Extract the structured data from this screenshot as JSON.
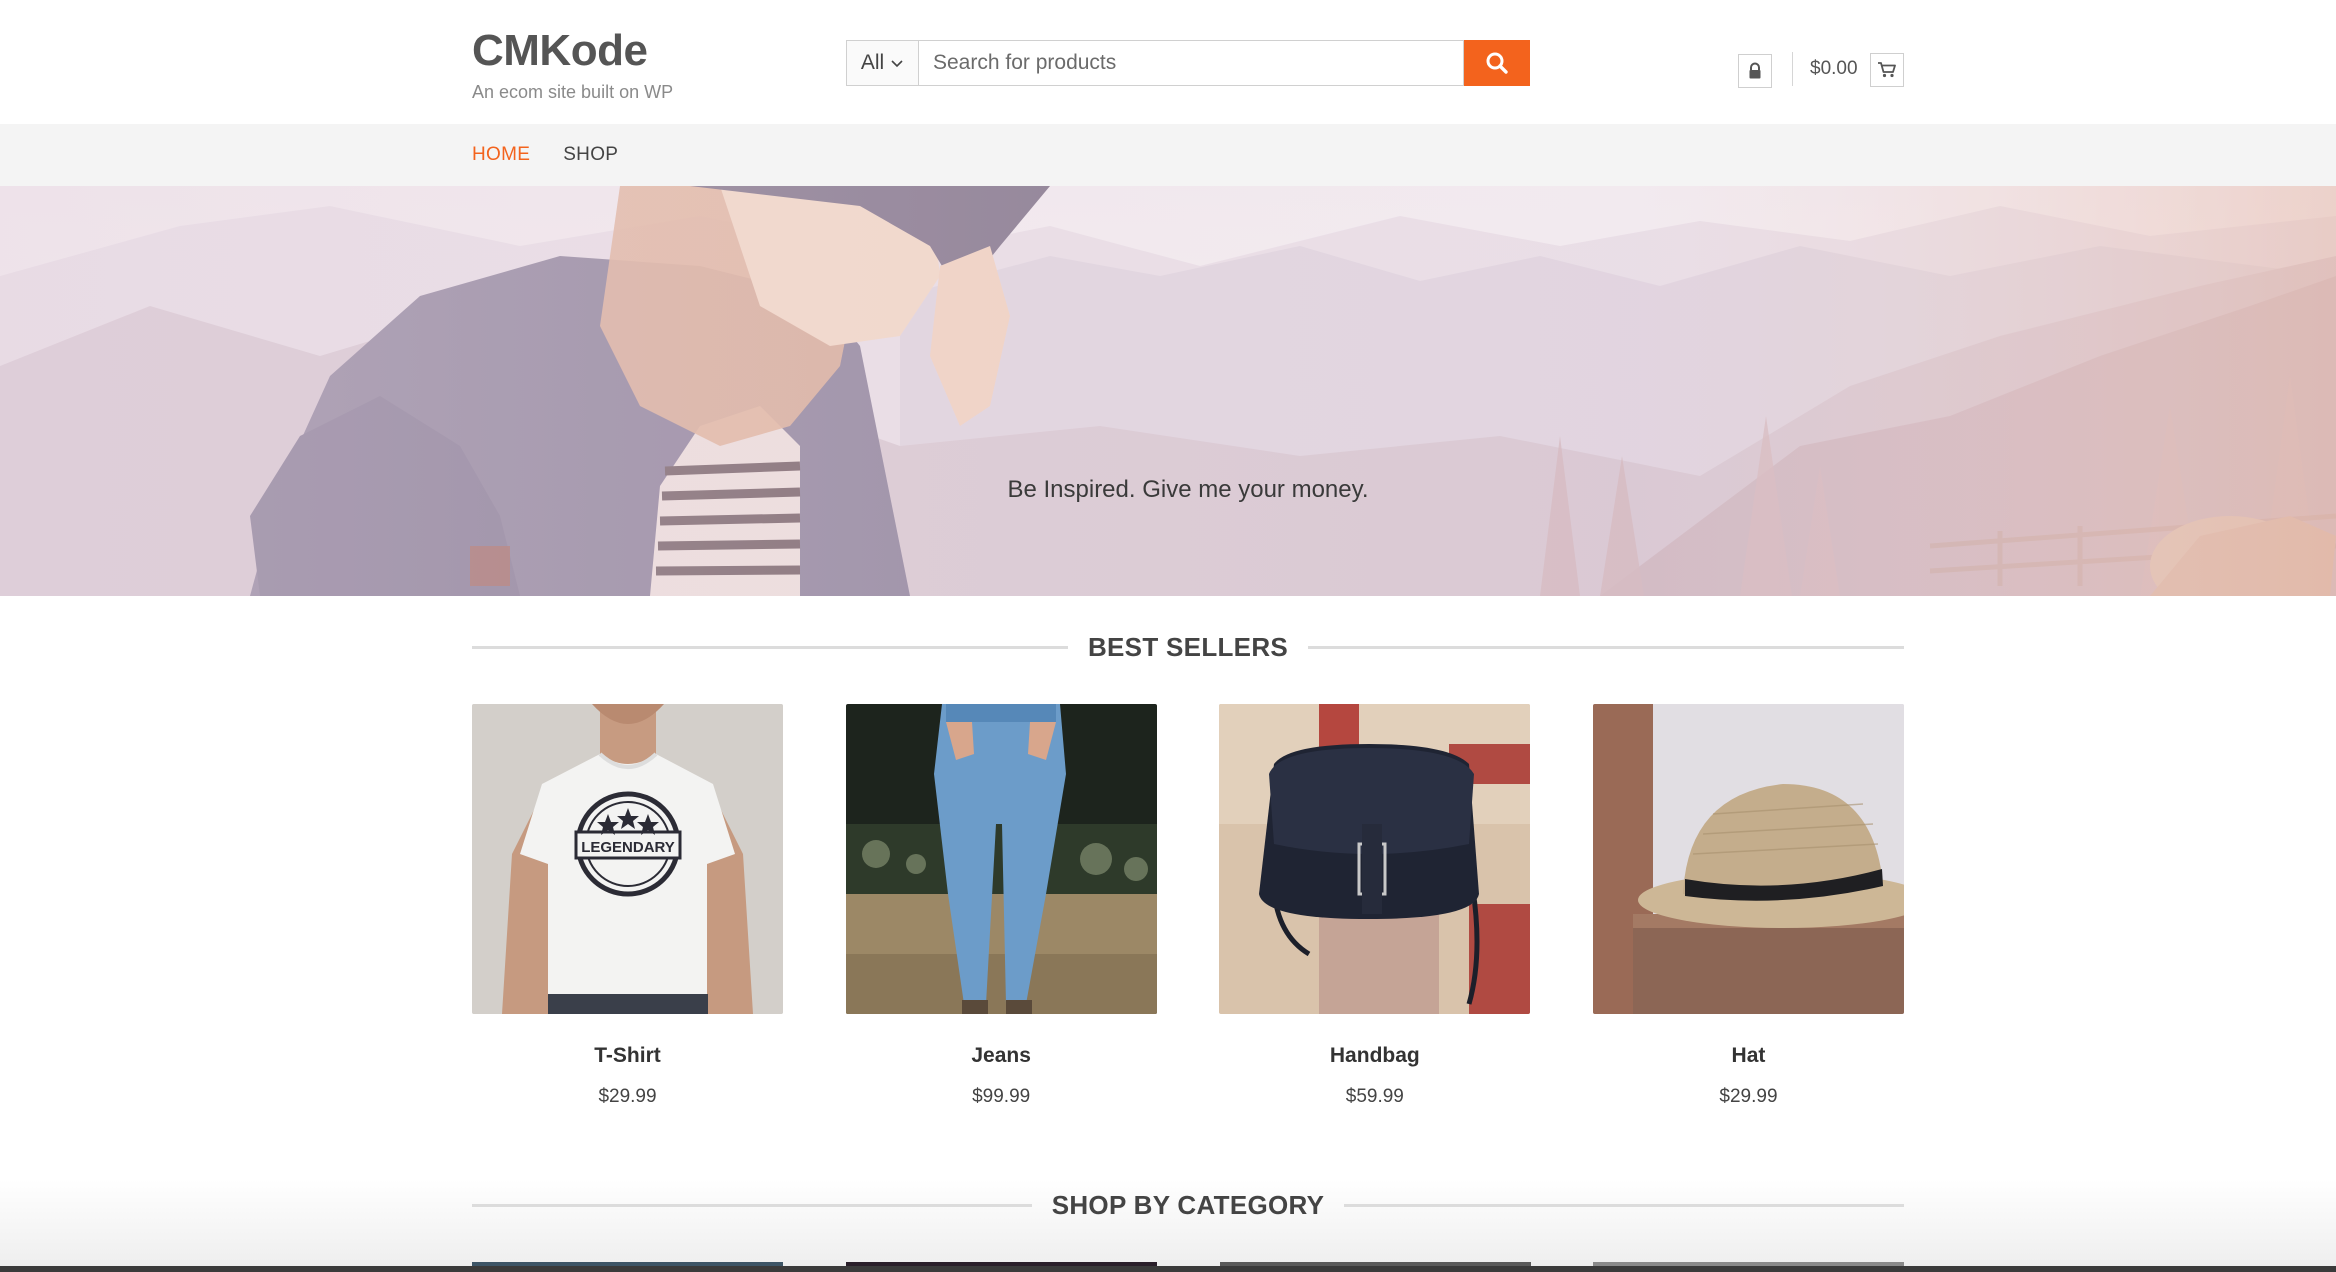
{
  "header": {
    "site_title": "CMKode",
    "tagline": "An ecom site built on WP",
    "search": {
      "category": "All",
      "placeholder": "Search for products"
    },
    "cart_total": "$0.00"
  },
  "nav": {
    "items": [
      {
        "label": "HOME",
        "active": true
      },
      {
        "label": "SHOP",
        "active": false
      }
    ]
  },
  "hero": {
    "text": "Be Inspired. Give me your money."
  },
  "best_sellers": {
    "title": "BEST SELLERS",
    "products": [
      {
        "name": "T-Shirt",
        "price": "$29.99",
        "print": "LEGENDARY"
      },
      {
        "name": "Jeans",
        "price": "$99.99"
      },
      {
        "name": "Handbag",
        "price": "$59.99"
      },
      {
        "name": "Hat",
        "price": "$29.99"
      }
    ]
  },
  "shop_by_category": {
    "title": "SHOP BY CATEGORY"
  },
  "colors": {
    "accent": "#f3631d",
    "nav_bg": "#f4f4f4",
    "text": "#444444"
  },
  "icons": {
    "search": "search-icon",
    "account": "lock-icon",
    "cart": "cart-icon",
    "dropdown": "chevron-down-icon"
  }
}
